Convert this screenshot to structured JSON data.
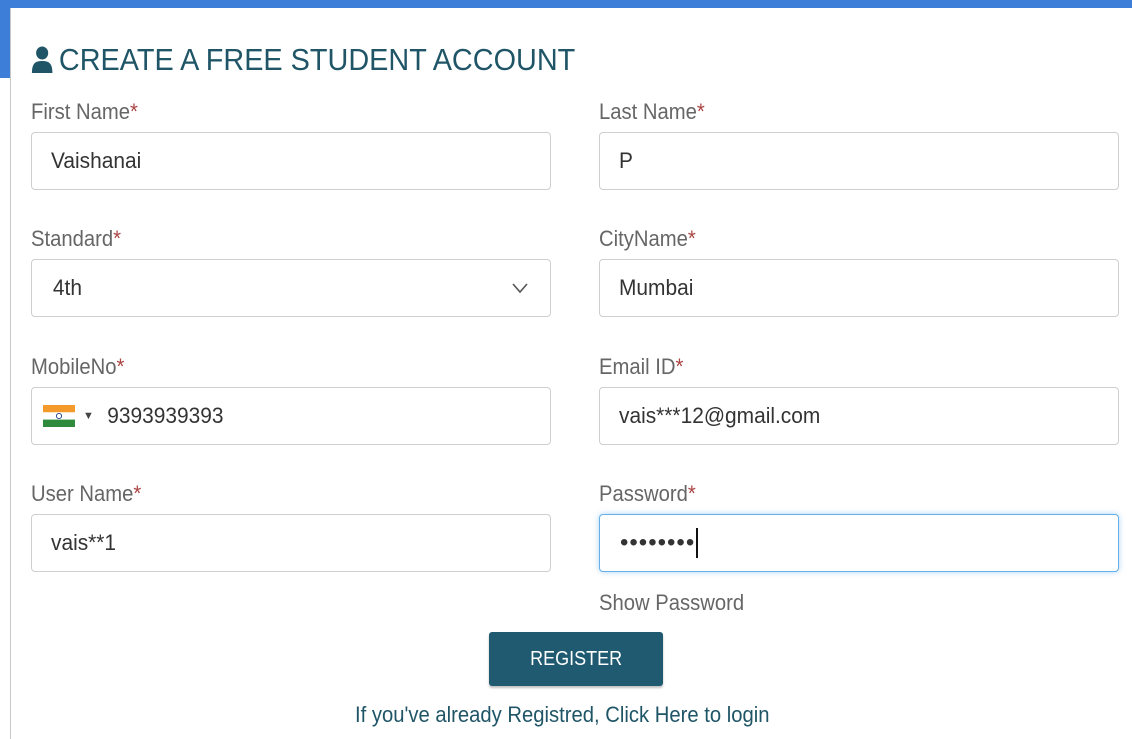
{
  "form": {
    "title": "CREATE A FREE STUDENT ACCOUNT",
    "required_marker": "*",
    "fields": {
      "first_name": {
        "label": "First Name",
        "value": "Vaishanai"
      },
      "last_name": {
        "label": "Last Name",
        "value": "P"
      },
      "standard": {
        "label": "Standard",
        "value": "4th"
      },
      "city": {
        "label": "CityName",
        "value": "Mumbai"
      },
      "mobile": {
        "label": "MobileNo",
        "value": "9393939393",
        "country_flag": "india-flag-icon"
      },
      "email": {
        "label": "Email ID",
        "value": "vais***12@gmail.com"
      },
      "username": {
        "label": "User Name",
        "value": "vais**1"
      },
      "password": {
        "label": "Password",
        "value": "••••••••"
      }
    },
    "show_password_label": "Show Password",
    "register_label": "REGISTER",
    "login_text": "If you've already Registred, Click Here to login"
  },
  "colors": {
    "accent": "#1f5a70",
    "title": "#1f5566",
    "required": "#a94442",
    "frame": "#3d7fd8",
    "focus": "#66afe9"
  }
}
